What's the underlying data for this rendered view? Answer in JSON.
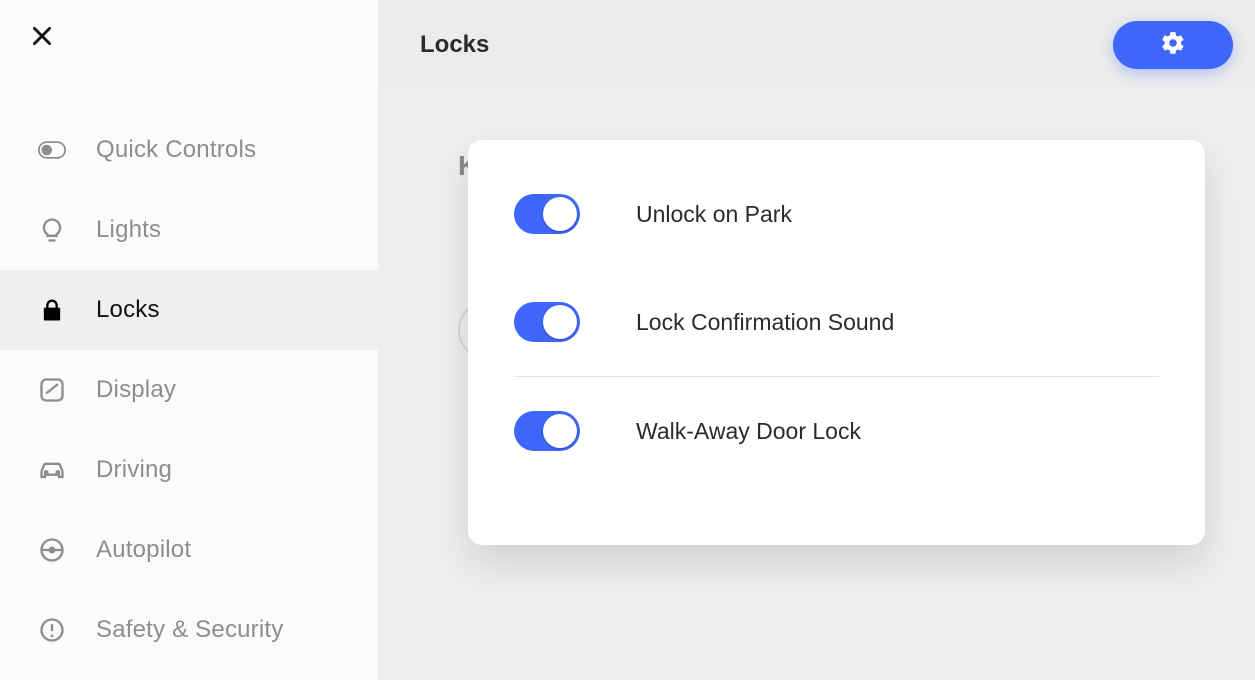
{
  "header": {
    "title": "Locks"
  },
  "sidebar": {
    "items": [
      {
        "id": "quick-controls",
        "label": "Quick Controls",
        "icon": "toggle-icon",
        "active": false
      },
      {
        "id": "lights",
        "label": "Lights",
        "icon": "bulb-icon",
        "active": false
      },
      {
        "id": "locks",
        "label": "Locks",
        "icon": "lock-icon",
        "active": true
      },
      {
        "id": "display",
        "label": "Display",
        "icon": "display-icon",
        "active": false
      },
      {
        "id": "driving",
        "label": "Driving",
        "icon": "car-icon",
        "active": false
      },
      {
        "id": "autopilot",
        "label": "Autopilot",
        "icon": "steering-icon",
        "active": false
      },
      {
        "id": "safety",
        "label": "Safety & Security",
        "icon": "alert-icon",
        "active": false
      }
    ]
  },
  "behind": {
    "char": "K"
  },
  "settings": {
    "unlock_on_park": {
      "label": "Unlock on Park",
      "value": true
    },
    "lock_confirmation_sound": {
      "label": "Lock Confirmation Sound",
      "value": true
    },
    "walk_away_door_lock": {
      "label": "Walk-Away Door Lock",
      "value": true
    }
  },
  "colors": {
    "accent": "#3e66fb"
  }
}
